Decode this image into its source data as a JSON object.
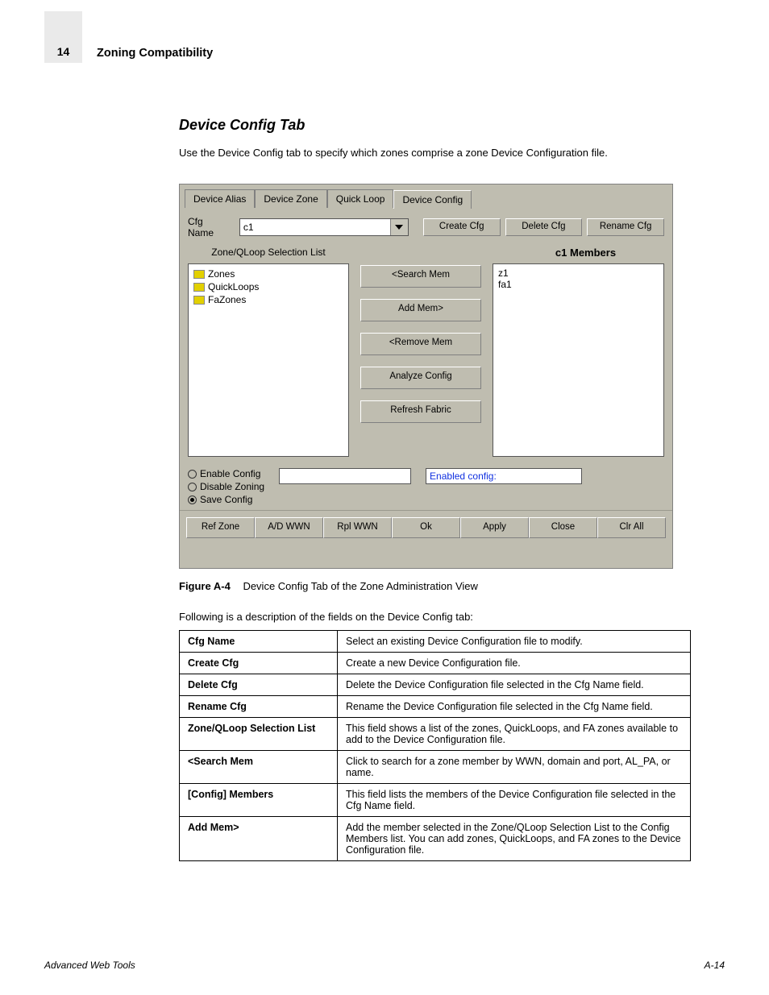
{
  "page": {
    "number": "14",
    "header_topic": "Zoning Compatibility",
    "footer_left": "Advanced Web Tools",
    "footer_right": "A-14"
  },
  "section": {
    "title": "Device Config Tab",
    "intro": "Use the Device Config tab to specify which zones comprise a zone Device Configuration file."
  },
  "figure": {
    "label": "Figure A-4",
    "caption": "Device Config Tab of the Zone Administration View"
  },
  "tabs": {
    "items": [
      "Device Alias",
      "Device Zone",
      "Quick Loop",
      "Device Config"
    ],
    "active_index": 3
  },
  "toolbar": {
    "cfg_name_label": "Cfg Name",
    "cfg_name_value": "c1",
    "create_cfg": "Create Cfg",
    "delete_cfg": "Delete Cfg",
    "rename_cfg": "Rename Cfg"
  },
  "lists": {
    "left_header": "Zone/QLoop Selection List",
    "right_header": "c1 Members",
    "tree": [
      "Zones",
      "QuickLoops",
      "FaZones"
    ],
    "members": [
      "z1",
      "fa1"
    ]
  },
  "center_buttons": {
    "search_mem": "<Search Mem",
    "add_mem": "Add Mem>",
    "remove_mem": "<Remove Mem",
    "analyze": "Analyze Config",
    "refresh": "Refresh Fabric"
  },
  "radios": {
    "enable": "Enable Config",
    "disable": "Disable Zoning",
    "save": "Save Config",
    "enabled_label": "Enabled config:"
  },
  "bottom": {
    "ref_zone": "Ref Zone",
    "ad_wwn": "A/D WWN",
    "rpl_wwn": "Rpl WWN",
    "ok": "Ok",
    "apply": "Apply",
    "close": "Close",
    "clr_all": "Clr All"
  },
  "table": {
    "intro": "Following is a description of the fields on the Device Config tab:",
    "rows": [
      {
        "field": "Cfg Name",
        "desc": "Select an existing Device Configuration file to modify."
      },
      {
        "field": "Create Cfg",
        "desc": "Create a new Device Configuration file."
      },
      {
        "field": "Delete Cfg",
        "desc": "Delete the Device Configuration file selected in the Cfg Name field."
      },
      {
        "field": "Rename Cfg",
        "desc": "Rename the Device Configuration file selected in the Cfg Name field."
      },
      {
        "field": "Zone/QLoop Selection List",
        "desc": "This field shows a list of the zones, QuickLoops, and FA zones available to add to the Device Configuration file."
      },
      {
        "field": "<Search Mem",
        "desc": "Click to search for a zone member by WWN, domain and port, AL_PA, or name."
      },
      {
        "field": "[Config] Members",
        "desc": "This field lists the members of the Device Configuration file selected in the Cfg Name field."
      },
      {
        "field": "Add Mem>",
        "desc": "Add the member selected in the Zone/QLoop Selection List to the Config Members list. You can add zones, QuickLoops, and FA zones to the Device Configuration file."
      }
    ]
  }
}
